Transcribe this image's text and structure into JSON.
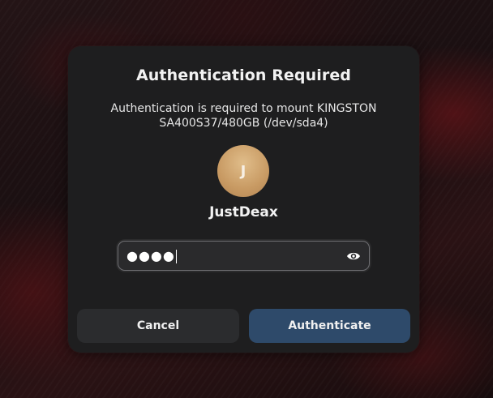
{
  "dialog": {
    "title": "Authentication Required",
    "message": "Authentication is required to mount KINGSTON SA400S37/480GB (/dev/sda4)",
    "avatar_initial": "J",
    "username": "JustDeax",
    "password": {
      "masked_value": "●●●●",
      "icon": "eye-icon"
    },
    "buttons": {
      "cancel_label": "Cancel",
      "authenticate_label": "Authenticate"
    }
  },
  "colors": {
    "dialog_background": "#1e1e1f",
    "avatar": "#c89a63",
    "authenticate_button": "#2e4a6a",
    "cancel_button": "#2b2c2e"
  }
}
